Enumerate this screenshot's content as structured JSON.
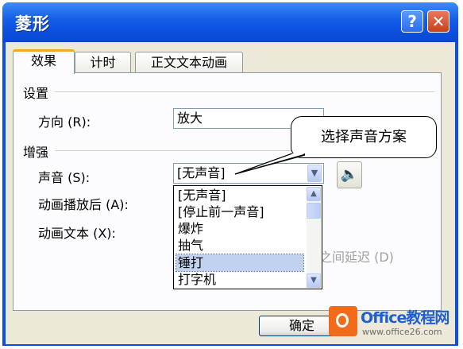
{
  "window": {
    "title": "菱形",
    "help_glyph": "?",
    "close_glyph": "✕"
  },
  "tabs": [
    {
      "label": "效果",
      "active": true
    },
    {
      "label": "计时",
      "active": false
    },
    {
      "label": "正文文本动画",
      "active": false
    }
  ],
  "groups": {
    "settings": "设置",
    "enhance": "增强"
  },
  "fields": {
    "direction": {
      "label": "方向 (R):",
      "value": "放大"
    },
    "sound": {
      "label": "声音 (S):",
      "value": "[无声音]"
    },
    "after_animation": {
      "label": "动画播放后 (A):"
    },
    "animate_text": {
      "label": "动画文本 (X):"
    },
    "delay_tail": "之间延迟 (D)"
  },
  "sound_options": [
    {
      "label": "[无声音]",
      "selected": false
    },
    {
      "label": "[停止前一声音]",
      "selected": false
    },
    {
      "label": "爆炸",
      "selected": false
    },
    {
      "label": "抽气",
      "selected": false
    },
    {
      "label": "锤打",
      "selected": true
    },
    {
      "label": "打字机",
      "selected": false
    }
  ],
  "callout": {
    "text": "选择声音方案"
  },
  "buttons": {
    "ok": "确定"
  },
  "watermark": {
    "brand": "Office教程网",
    "url": "www.office26.com"
  },
  "icons": {
    "speaker": "speaker-icon",
    "dropdown": "chevron-down-icon"
  },
  "colors": {
    "titlebar": "#0c50df",
    "close": "#c8401b",
    "tab_accent": "#f5a623",
    "selected_item": "#c1d2ee"
  }
}
